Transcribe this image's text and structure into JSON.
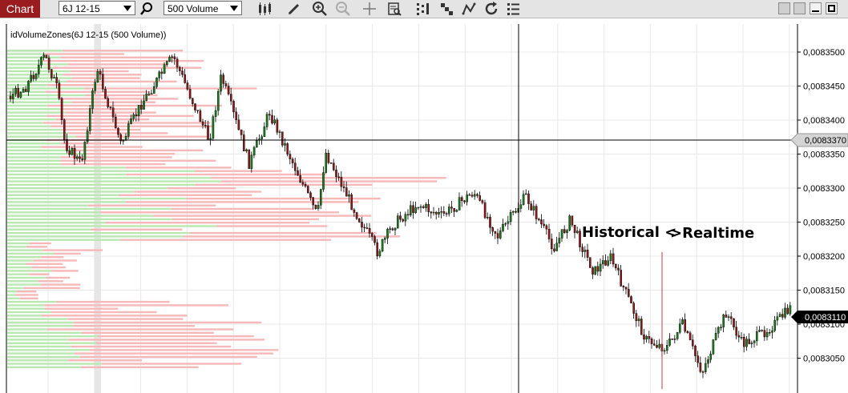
{
  "toolbar": {
    "chart_tab_label": "Chart",
    "instrument_value": "6J 12-15",
    "period_value": "500 Volume",
    "icons": [
      "search-icon",
      "bar-type-icon",
      "draw-pencil-icon",
      "zoom-in-icon",
      "zoom-out-icon",
      "crosshair-icon",
      "data-box-icon",
      "indicators-icon",
      "strategies-icon",
      "chart-trader-icon",
      "reload-icon",
      "properties-icon"
    ],
    "window_controls": [
      "restore-icon",
      "minimize-icon",
      "maximize-icon",
      "close-icon"
    ]
  },
  "indicator_label": "idVolumeZones(6J 12-15 (500 Volume))",
  "annotations": {
    "historical": "Historical <",
    "realtime": ">Realtime"
  },
  "colors": {
    "accent": "#9b1c1f",
    "up_candle": "#1b7a1b",
    "down_candle": "#8b1a1a",
    "buy_zone": "#b9e8b0",
    "sell_zone": "#f6b8b8",
    "realtime_marker": "#d23a3a"
  },
  "price_axis": {
    "tick_labels": [
      "0,0083500",
      "0,0083450",
      "0,0083400",
      "0,0083350",
      "0,0083300",
      "0,0083250",
      "0,0083200",
      "0,0083150",
      "0,0083100",
      "0,0083050"
    ],
    "crosshair_price": "0,0083370",
    "last_price": "0,0083110"
  }
}
